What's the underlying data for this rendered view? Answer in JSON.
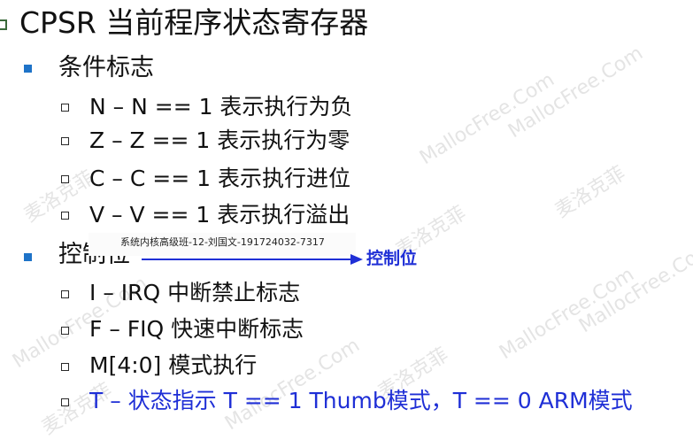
{
  "title": "CPSR 当前程序状态寄存器",
  "sections": [
    {
      "label": "条件标志",
      "items": [
        "N – N == 1 表示执行为负",
        "Z – Z == 1 表示执行为零",
        "C – C == 1 表示执行进位",
        "V – V == 1 表示执行溢出"
      ]
    },
    {
      "label": "控制位",
      "items": [
        "I – IRQ 中断禁止标志",
        "F – FIQ 快速中断标志",
        "M[4:0] 模式执行",
        "T – 状态指示 T == 1 Thumb模式，T == 0 ARM模式"
      ]
    }
  ],
  "caption": "系统内核高级班-12-刘国文-191724032-7317",
  "arrow_label": "控制位",
  "watermark": {
    "latin": "MallocFree.Com",
    "cjk": "麦洛克菲"
  },
  "colors": {
    "highlight_text": "#1f2fd6",
    "section_bullet": "#1e73c8"
  }
}
